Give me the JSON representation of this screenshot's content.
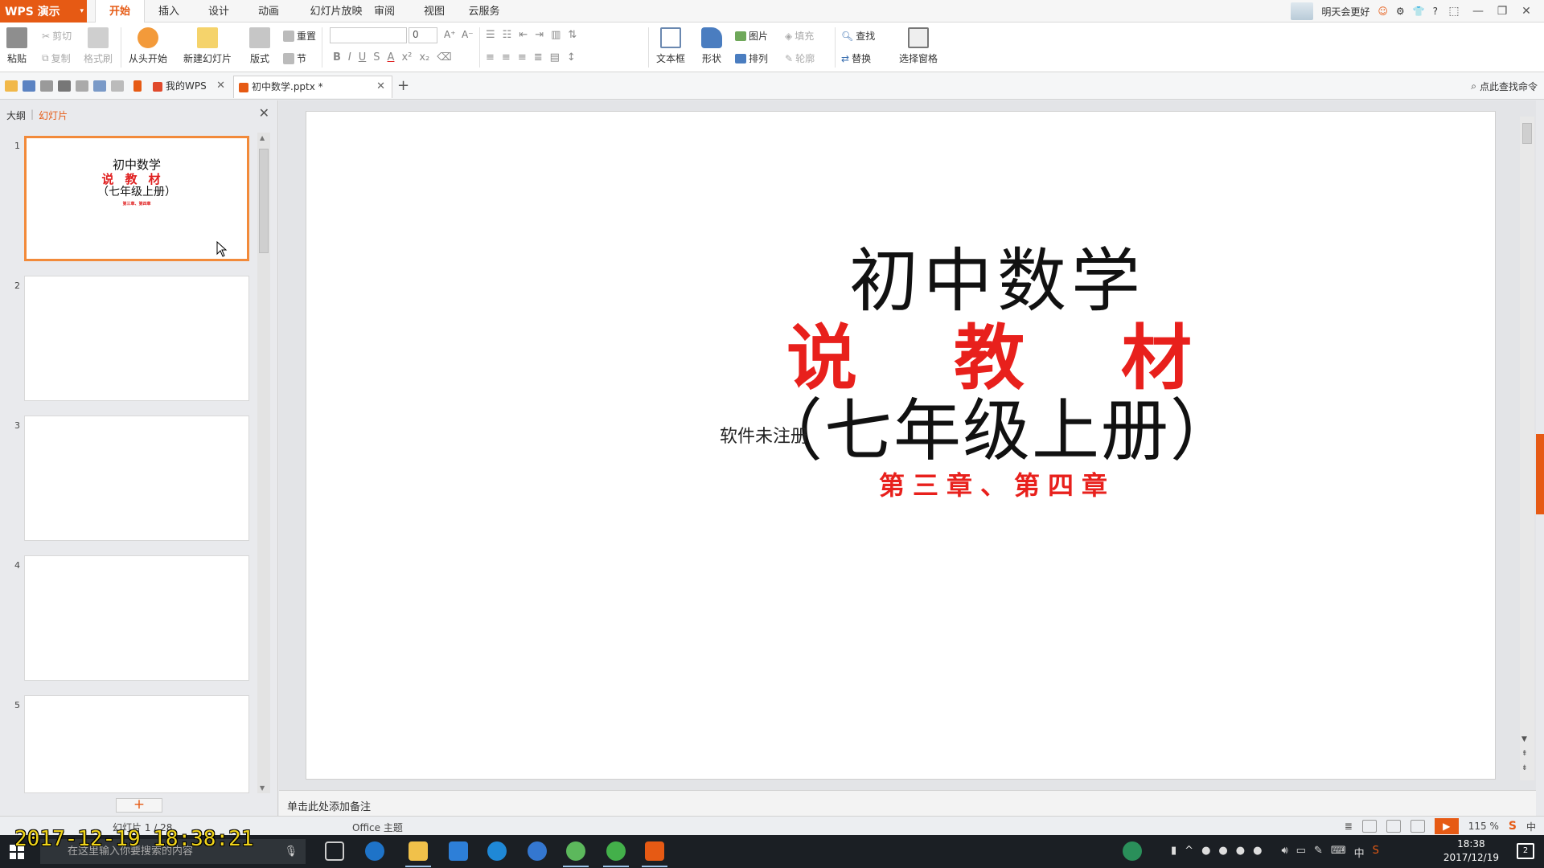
{
  "app": {
    "logo_label": "WPS 演示",
    "user_greeting": "明天会更好",
    "help_label": "?",
    "colors": {
      "brand": "#e65a14",
      "accent_red": "#e8201c"
    }
  },
  "menu": {
    "tabs": [
      "开始",
      "插入",
      "设计",
      "动画",
      "幻灯片放映",
      "审阅",
      "视图",
      "云服务"
    ],
    "active": "开始"
  },
  "ribbon": {
    "paste": "粘贴",
    "cut": "剪切",
    "copy": "复制",
    "format_painter": "格式刷",
    "from_start": "从头开始",
    "new_slide": "新建幻灯片",
    "layout": "版式",
    "reset": "重置",
    "section": "节",
    "font_name": "",
    "font_size": "0",
    "textbox": "文本框",
    "shape": "形状",
    "picture": "图片",
    "fill": "填充",
    "arrange": "排列",
    "outline": "轮廓",
    "find": "查找",
    "replace": "替换",
    "selection_pane": "选择窗格",
    "bold": "B",
    "italic": "I",
    "underline": "U",
    "strike": "S",
    "font_color": "A"
  },
  "doc_tabs": [
    {
      "label": "我的WPS"
    },
    {
      "label": "初中数学.pptx *"
    }
  ],
  "search_command": "点此查找命令",
  "left_panel": {
    "tab_outline": "大纲",
    "tab_slides": "幻灯片",
    "thumbs": [
      "1",
      "2",
      "3",
      "4",
      "5"
    ],
    "thumb1": {
      "line1": "初中数学",
      "line2": "说教材",
      "line3": "（七年级上册）",
      "line4": "第三章、第四章"
    }
  },
  "slide": {
    "title": "初中数学",
    "subtitle": "说教材",
    "grade": "（七年级上册）",
    "chapters": "第三章、第四章",
    "watermark": "软件未注册"
  },
  "notes_placeholder": "单击此处添加备注",
  "status": {
    "slide_counter": "幻灯片 1 / 28",
    "theme": "Office 主题",
    "zoom": "115 %"
  },
  "taskbar": {
    "search_placeholder": "在这里输入你要搜索的内容",
    "time": "18:38",
    "date": "2017/12/19",
    "ime": "中",
    "notifications": "2"
  },
  "overlay_timestamp": "2017-12-19 18:38:21"
}
